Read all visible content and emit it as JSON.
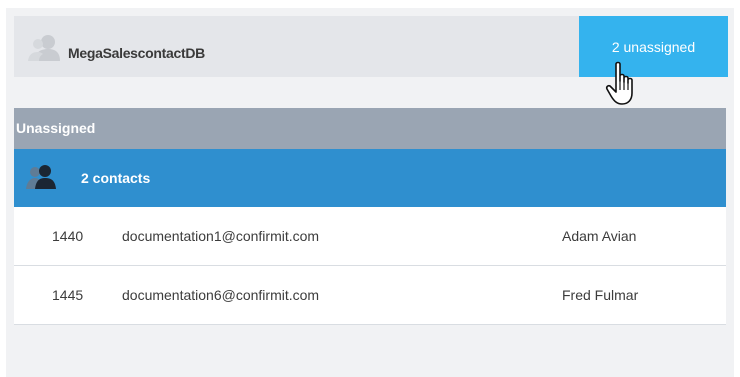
{
  "database": {
    "name": "MegaSalescontactDB",
    "icon": "user-silhouette-icon"
  },
  "unassigned_button": {
    "label": "2 unassigned",
    "color": "#34b3ee"
  },
  "section": {
    "title": "Unassigned"
  },
  "group": {
    "label": "2 contacts",
    "icon": "users-icon"
  },
  "contacts": [
    {
      "id": "1440",
      "email": "documentation1@confirmit.com",
      "name": "Adam Avian"
    },
    {
      "id": "1445",
      "email": "documentation6@confirmit.com",
      "name": "Fred Fulmar"
    }
  ],
  "colors": {
    "header_bg": "#9aa5b3",
    "group_bg": "#2f8fcf"
  }
}
